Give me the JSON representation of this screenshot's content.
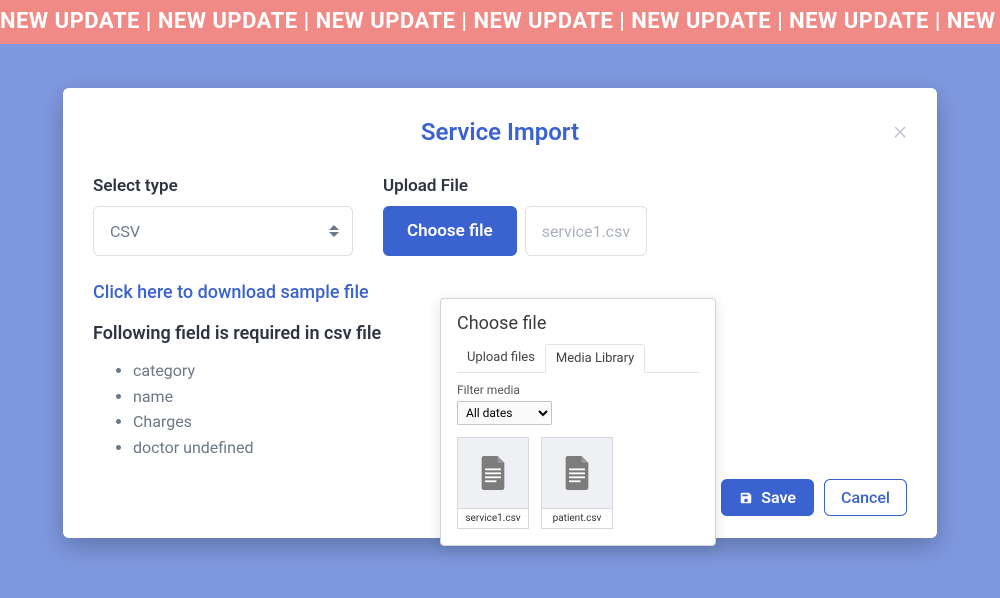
{
  "ticker": {
    "text": "NEW UPDATE | NEW UPDATE | NEW UPDATE | NEW UPDATE | NEW UPDATE | NEW UPDATE | NEW UP"
  },
  "modal": {
    "title": "Service Import",
    "close_glyph": "×"
  },
  "type_field": {
    "label": "Select type",
    "value": "CSV"
  },
  "upload_field": {
    "label": "Upload File",
    "button": "Choose file",
    "filename": "service1.csv"
  },
  "sample_link": "Click here to download sample file",
  "required_heading": "Following field is required in csv file",
  "required_fields": [
    "category",
    "name",
    "Charges",
    "doctor undefined"
  ],
  "chooser": {
    "title": "Choose file",
    "tabs": {
      "upload": "Upload files",
      "library": "Media Library"
    },
    "filter_label": "Filter media",
    "filter_value": "All dates",
    "media": [
      {
        "name": "service1.csv"
      },
      {
        "name": "patient.csv"
      }
    ]
  },
  "footer": {
    "save": "Save",
    "cancel": "Cancel"
  }
}
